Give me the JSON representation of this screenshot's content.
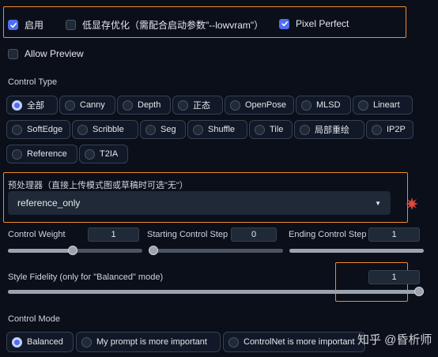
{
  "top_options": {
    "enable_label": "启用",
    "lowvram_label": "低显存优化（需配合启动参数\"--lowvram\"）",
    "pixel_perfect_label": "Pixel Perfect",
    "allow_preview_label": "Allow Preview",
    "enable_checked": true,
    "lowvram_checked": false,
    "pixel_perfect_checked": true,
    "allow_preview_checked": false
  },
  "control_type": {
    "title": "Control Type",
    "selected": "全部",
    "options": [
      "全部",
      "Canny",
      "Depth",
      "正态",
      "OpenPose",
      "MLSD",
      "Lineart",
      "SoftEdge",
      "Scribble",
      "Seg",
      "Shuffle",
      "Tile",
      "局部重绘",
      "IP2P",
      "Reference",
      "T2IA"
    ]
  },
  "preprocessor": {
    "label": "预处理器（直接上传模式图或草稿时可选\"无\"）",
    "value": "reference_only"
  },
  "sliders": {
    "control_weight": {
      "label": "Control Weight",
      "value": "1",
      "fraction": 0.48
    },
    "starting_step": {
      "label": "Starting Control Step",
      "value": "0",
      "fraction": 0.0
    },
    "ending_step": {
      "label": "Ending Control Step",
      "value": "1",
      "fraction": 1.0
    },
    "style_fidelity": {
      "label": "Style Fidelity (only for \"Balanced\" mode)",
      "value": "1",
      "fraction": 1.0
    }
  },
  "control_mode": {
    "title": "Control Mode",
    "selected": "Balanced",
    "options": [
      "Balanced",
      "My prompt is more important",
      "ControlNet is more important"
    ]
  },
  "watermark": "知乎 @昏析师",
  "colors": {
    "accent": "#4f6df5",
    "highlight": "#f08a2c",
    "background": "#0b0f19"
  }
}
